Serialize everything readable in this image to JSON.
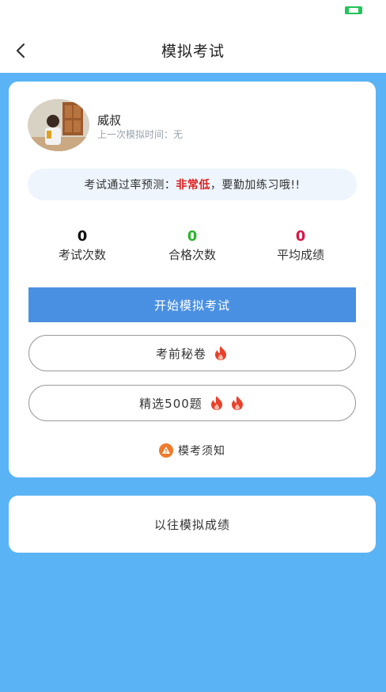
{
  "header": {
    "title": "模拟考试"
  },
  "user": {
    "name": "威叔",
    "last_label": "上一次模拟时间：",
    "last_value": "无"
  },
  "prediction": {
    "prefix": "考试通过率预测：",
    "level": "非常低",
    "suffix": "，要勤加练习哦!!",
    "level_color": "#e02020"
  },
  "stats": [
    {
      "value": "0",
      "label": "考试次数",
      "color": "#111111"
    },
    {
      "value": "0",
      "label": "合格次数",
      "color": "#2db52d"
    },
    {
      "value": "0",
      "label": "平均成绩",
      "color": "#d4184a"
    }
  ],
  "buttons": {
    "start": "开始模拟考试",
    "secret": "考前秘卷",
    "selected": "精选500题"
  },
  "notice": "模考须知",
  "history": "以往模拟成绩",
  "colors": {
    "background": "#5ab3f5",
    "primary": "#4a90e2",
    "fire": "#e8412c",
    "warning": "#f07a2a"
  }
}
